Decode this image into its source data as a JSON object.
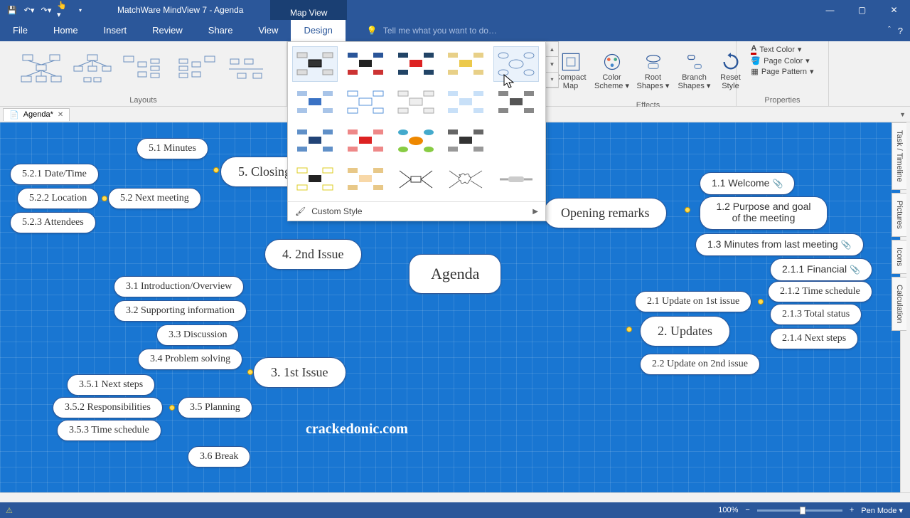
{
  "title": "MatchWare MindView 7 - Agenda",
  "contextTab": "Map View",
  "menus": {
    "file": "File",
    "home": "Home",
    "insert": "Insert",
    "review": "Review",
    "share": "Share",
    "view": "View",
    "design": "Design"
  },
  "tellme": "Tell me what you want to do…",
  "ribbon": {
    "layouts": "Layouts",
    "effects": "Effects",
    "properties": "Properties",
    "compactMap": "Compact Map",
    "colorScheme": "Color Scheme",
    "rootShapes": "Root Shapes",
    "branchShapes": "Branch Shapes",
    "resetStyle": "Reset Style",
    "textColor": "Text Color",
    "pageColor": "Page Color",
    "pagePattern": "Page Pattern",
    "customStyle": "Custom Style"
  },
  "docTab": "Agenda*",
  "sideTabs": {
    "task": "Task / Timeline",
    "pictures": "Pictures",
    "icons": "Icons",
    "calc": "Calculation"
  },
  "nodes": {
    "center": "Agenda",
    "n1": "Opening remarks",
    "n1_1": "1.1  Welcome",
    "n1_2": "1.2   Purpose and goal of the meeting",
    "n1_3": "1.3  Minutes from last meeting",
    "n2": "2.  Updates",
    "n2_1": "2.1  Update on 1st issue",
    "n2_1_1": "2.1.1  Financial",
    "n2_1_2": "2.1.2  Time schedule",
    "n2_1_3": "2.1.3  Total status",
    "n2_1_4": "2.1.4  Next steps",
    "n2_2": "2.2  Update on 2nd issue",
    "n3": "3.  1st Issue",
    "n3_1": "3.1  Introduction/Overview",
    "n3_2": "3.2  Supporting information",
    "n3_3": "3.3  Discussion",
    "n3_4": "3.4  Problem solving",
    "n3_5": "3.5  Planning",
    "n3_5_1": "3.5.1  Next steps",
    "n3_5_2": "3.5.2  Responsibilities",
    "n3_5_3": "3.5.3  Time schedule",
    "n3_6": "3.6  Break",
    "n4": "4.  2nd Issue",
    "n5": "5.  Closing",
    "n5_1": "5.1  Minutes",
    "n5_2": "5.2  Next meeting",
    "n5_2_1": "5.2.1  Date/Time",
    "n5_2_2": "5.2.2  Location",
    "n5_2_3": "5.2.3  Attendees"
  },
  "watermark": "crackedonic.com",
  "status": {
    "zoom": "100%",
    "penMode": "Pen Mode"
  }
}
